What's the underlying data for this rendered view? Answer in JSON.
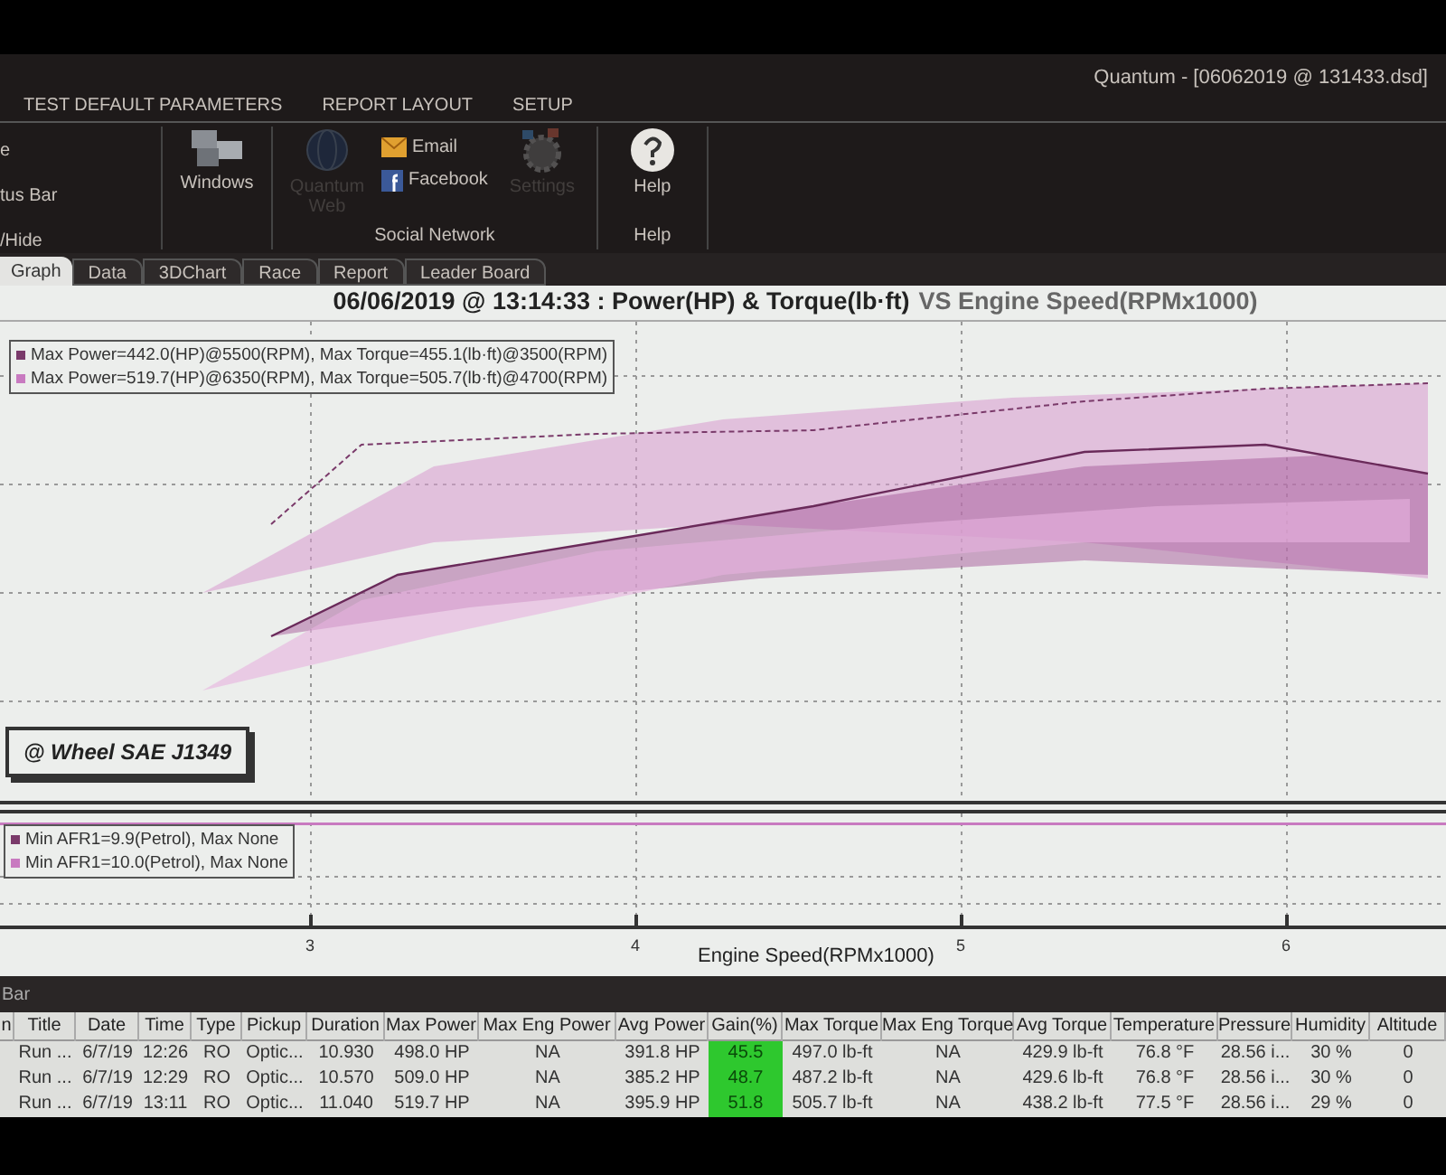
{
  "window": {
    "title": "Quantum - [06062019 @ 131433.dsd]"
  },
  "menu": [
    {
      "label": "TEST DEFAULT PARAMETERS",
      "selected": false
    },
    {
      "label": "REPORT LAYOUT",
      "selected": false
    },
    {
      "label": "SETUP",
      "selected": false
    }
  ],
  "ribbon": {
    "cut_items": [
      "e",
      "tus Bar",
      "/Hide"
    ],
    "groups": [
      {
        "items": [
          {
            "kind": "large",
            "label": "Windows",
            "disabled": false
          }
        ]
      },
      {
        "label": "Social Network",
        "items": [
          {
            "kind": "large",
            "label": "Quantum Web",
            "disabled": true
          },
          {
            "kind": "small",
            "label": "Email",
            "disabled": false
          },
          {
            "kind": "small",
            "label": "Facebook",
            "disabled": false
          },
          {
            "kind": "large",
            "label": "Settings",
            "disabled": true
          }
        ]
      },
      {
        "label": "Help",
        "items": [
          {
            "kind": "large",
            "label": "Help",
            "disabled": false
          }
        ]
      }
    ]
  },
  "tabs": [
    {
      "label": "Graph",
      "selected": true
    },
    {
      "label": "Data",
      "selected": false
    },
    {
      "label": "3DChart",
      "selected": false
    },
    {
      "label": "Race",
      "selected": false
    },
    {
      "label": "Report",
      "selected": false
    },
    {
      "label": "Leader Board",
      "selected": false
    }
  ],
  "chart": {
    "title_dark": "06/06/2019 @ 13:14:33 : Power(HP) & Torque(lb·ft)",
    "title_light": "VS Engine Speed(RPMx1000)",
    "legend": [
      {
        "text": "Max Power=442.0(HP)@5500(RPM), Max Torque=455.1(lb·ft)@3500(RPM)",
        "color": "#7a3a6a"
      },
      {
        "text": "Max Power=519.7(HP)@6350(RPM), Max Torque=505.7(lb·ft)@4700(RPM)",
        "color": "#c87ac0"
      }
    ],
    "correction": "@ Wheel SAE J1349",
    "afr_legend": [
      {
        "text": "Min AFR1=9.9(Petrol), Max None",
        "color": "#7a3a6a"
      },
      {
        "text": "Min AFR1=10.0(Petrol), Max None",
        "color": "#c87ac0"
      }
    ],
    "x_ticks": [
      "3",
      "4",
      "5",
      "6"
    ],
    "x_label": "Engine Speed(RPMx1000)"
  },
  "table": {
    "bar_title": "Bar",
    "columns": [
      {
        "label": "n",
        "highlight": false
      },
      {
        "label": "Title",
        "highlight": false
      },
      {
        "label": "Date",
        "highlight": false
      },
      {
        "label": "Time",
        "highlight": false
      },
      {
        "label": "Type",
        "highlight": false
      },
      {
        "label": "Pickup",
        "highlight": false
      },
      {
        "label": "Duration",
        "highlight": false
      },
      {
        "label": "Max Power",
        "highlight": false
      },
      {
        "label": "Max Eng Power",
        "highlight": false
      },
      {
        "label": "Avg Power",
        "highlight": false
      },
      {
        "label": "Gain(%)",
        "highlight": true
      },
      {
        "label": "Max Torque",
        "highlight": false
      },
      {
        "label": "Max Eng Torque",
        "highlight": false
      },
      {
        "label": "Avg Torque",
        "highlight": false
      },
      {
        "label": "Temperature",
        "highlight": false
      },
      {
        "label": "Pressure",
        "highlight": false
      },
      {
        "label": "Humidity",
        "highlight": false
      },
      {
        "label": "Altitude",
        "highlight": false
      }
    ],
    "rows": [
      [
        "",
        "Run ...",
        "6/7/19",
        "12:26",
        "RO",
        "Optic...",
        "10.930",
        "498.0 HP",
        "NA",
        "391.8 HP",
        "45.5",
        "497.0 lb-ft",
        "NA",
        "429.9 lb-ft",
        "76.8 °F",
        "28.56 i...",
        "30 %",
        "0"
      ],
      [
        "",
        "Run ...",
        "6/7/19",
        "12:29",
        "RO",
        "Optic...",
        "10.570",
        "509.0 HP",
        "NA",
        "385.2 HP",
        "48.7",
        "487.2 lb-ft",
        "NA",
        "429.6 lb-ft",
        "76.8 °F",
        "28.56 i...",
        "30 %",
        "0"
      ],
      [
        "",
        "Run ...",
        "6/7/19",
        "13:11",
        "RO",
        "Optic...",
        "11.040",
        "519.7 HP",
        "NA",
        "395.9 HP",
        "51.8",
        "505.7 lb-ft",
        "NA",
        "438.2 lb-ft",
        "77.5 °F",
        "28.56 i...",
        "29 %",
        "0"
      ]
    ]
  }
}
